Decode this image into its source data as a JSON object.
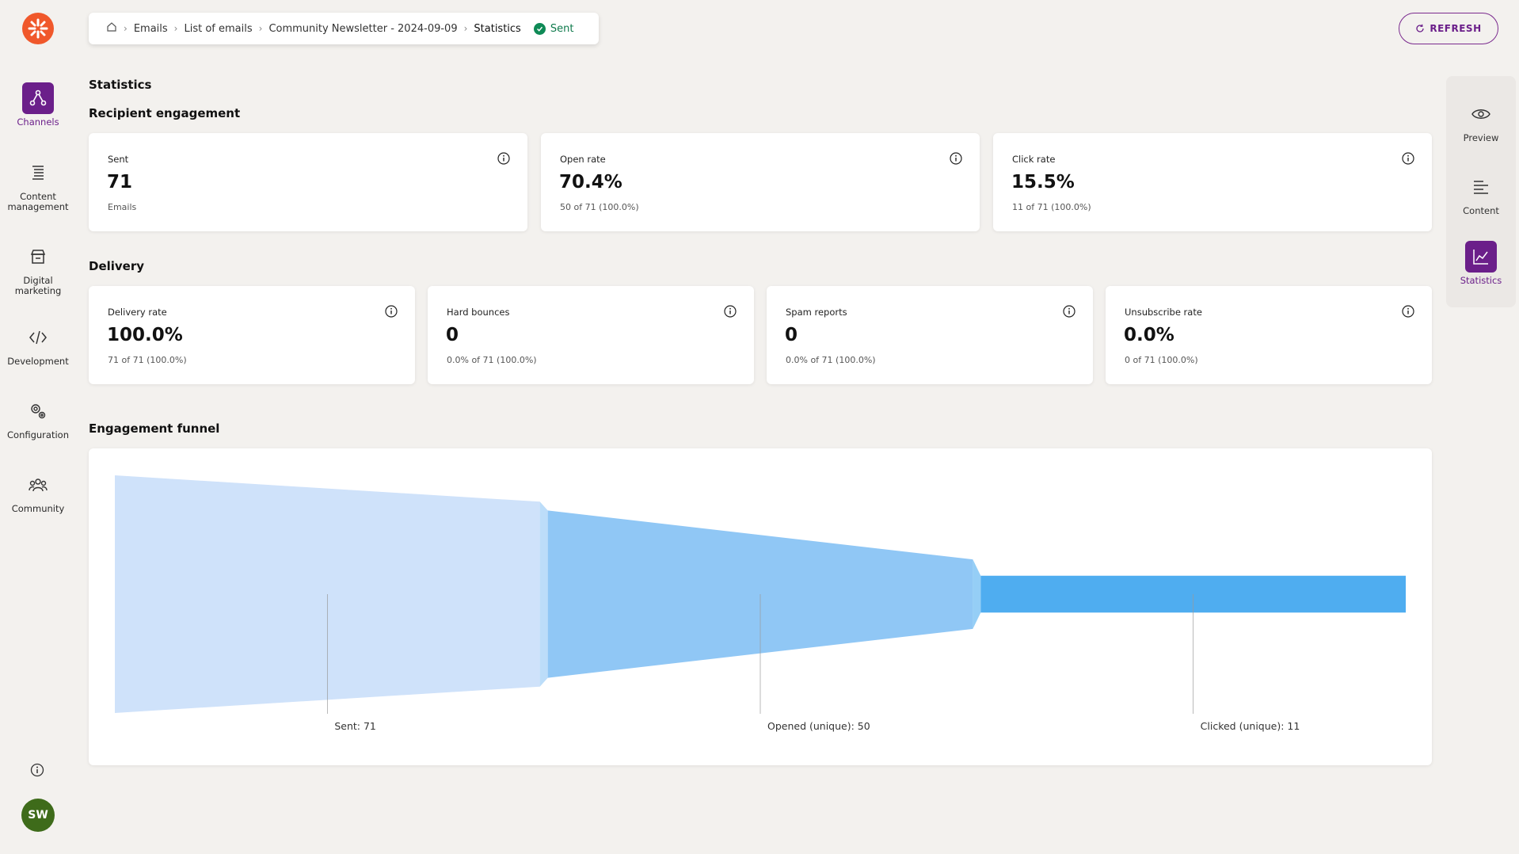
{
  "nav": {
    "items": [
      {
        "label": "Channels",
        "icon": "channels-icon",
        "active": true
      },
      {
        "label": "Content management",
        "icon": "content-management-icon"
      },
      {
        "label": "Digital marketing",
        "icon": "digital-marketing-icon"
      },
      {
        "label": "Development",
        "icon": "code-icon"
      },
      {
        "label": "Configuration",
        "icon": "gear-icon"
      },
      {
        "label": "Community",
        "icon": "community-icon"
      }
    ],
    "avatar_initials": "SW"
  },
  "breadcrumb": {
    "items": [
      "Emails",
      "List of emails",
      "Community Newsletter - 2024-09-09",
      "Statistics"
    ],
    "status": "Sent"
  },
  "refresh_label": "REFRESH",
  "right_panel": {
    "items": [
      {
        "label": "Preview",
        "icon": "eye-icon"
      },
      {
        "label": "Content",
        "icon": "content-lines-icon"
      },
      {
        "label": "Statistics",
        "icon": "chart-icon",
        "active": true
      }
    ]
  },
  "page_title": "Statistics",
  "engagement": {
    "heading": "Recipient engagement",
    "cards": [
      {
        "title": "Sent",
        "value": "71",
        "sub": "Emails"
      },
      {
        "title": "Open rate",
        "value": "70.4%",
        "sub": "50 of 71 (100.0%)"
      },
      {
        "title": "Click rate",
        "value": "15.5%",
        "sub": "11 of 71 (100.0%)"
      }
    ]
  },
  "delivery": {
    "heading": "Delivery",
    "cards": [
      {
        "title": "Delivery rate",
        "value": "100.0%",
        "sub": "71 of 71 (100.0%)"
      },
      {
        "title": "Hard bounces",
        "value": "0",
        "sub": "0.0% of 71 (100.0%)"
      },
      {
        "title": "Spam reports",
        "value": "0",
        "sub": "0.0% of 71 (100.0%)"
      },
      {
        "title": "Unsubscribe rate",
        "value": "0.0%",
        "sub": "0 of 71 (100.0%)"
      }
    ]
  },
  "funnel": {
    "heading": "Engagement funnel"
  },
  "colors": {
    "accent": "#6b1f8a",
    "brand_orange": "#f0582b",
    "sent_green": "#0f8a56",
    "funnel": [
      "#cfe2fa",
      "#90c7f5",
      "#4fadf0"
    ]
  },
  "chart_data": {
    "type": "funnel",
    "categories": [
      "Sent",
      "Opened (unique)",
      "Clicked (unique)"
    ],
    "values": [
      71,
      50,
      11
    ],
    "labels": [
      "Sent: 71",
      "Opened (unique): 50",
      "Clicked (unique): 11"
    ]
  }
}
